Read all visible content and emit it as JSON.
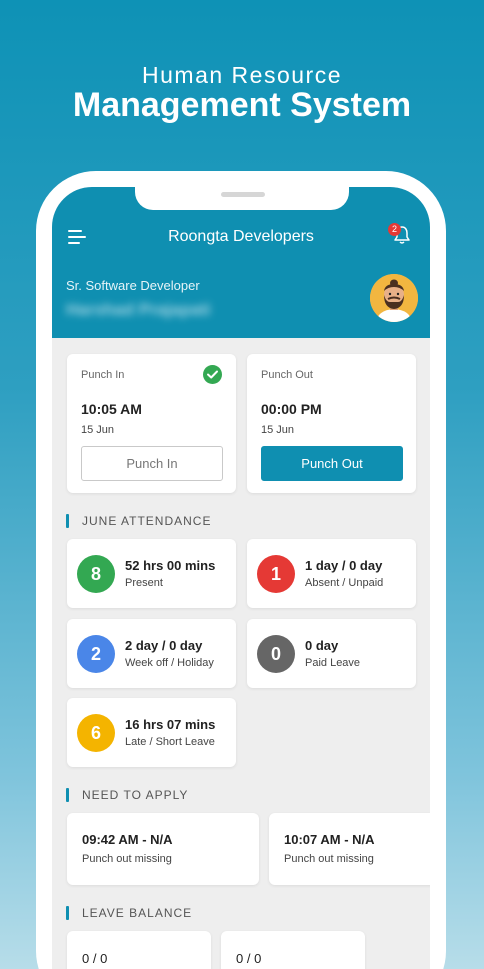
{
  "hero": {
    "subtitle": "Human Resource",
    "title": "Management System"
  },
  "app": {
    "title": "Roongta Developers",
    "notification_count": "2",
    "job_title": "Sr. Software Developer",
    "user_name": "Harshad Prajapati"
  },
  "punch_in": {
    "label": "Punch In",
    "time": "10:05 AM",
    "date": "15 Jun",
    "button": "Punch In",
    "done": true
  },
  "punch_out": {
    "label": "Punch Out",
    "time": "00:00 PM",
    "date": "15 Jun",
    "button": "Punch Out"
  },
  "attendance": {
    "title": "JUNE ATTENDANCE",
    "items": [
      {
        "count": "8",
        "value": "52 hrs 00 mins",
        "label": "Present",
        "color": "#33a852"
      },
      {
        "count": "1",
        "value": "1 day / 0 day",
        "label": "Absent / Unpaid",
        "color": "#e53935"
      },
      {
        "count": "2",
        "value": "2 day / 0 day",
        "label": "Week off / Holiday",
        "color": "#4a86e8"
      },
      {
        "count": "0",
        "value": "0 day",
        "label": "Paid Leave",
        "color": "#666666"
      },
      {
        "count": "6",
        "value": "16 hrs 07 mins",
        "label": "Late / Short Leave",
        "color": "#f4b400"
      }
    ]
  },
  "need_to_apply": {
    "title": "NEED TO APPLY",
    "items": [
      {
        "time": "09:42 AM - N/A",
        "status": "Punch out missing"
      },
      {
        "time": "10:07 AM - N/A",
        "status": "Punch out missing"
      }
    ]
  },
  "leave_balance": {
    "title": "LEAVE BALANCE",
    "items": [
      {
        "value": "0 / 0"
      },
      {
        "value": "0 / 0"
      }
    ]
  },
  "colors": {
    "primary": "#0f8fb1",
    "background": "#eeeeee"
  }
}
